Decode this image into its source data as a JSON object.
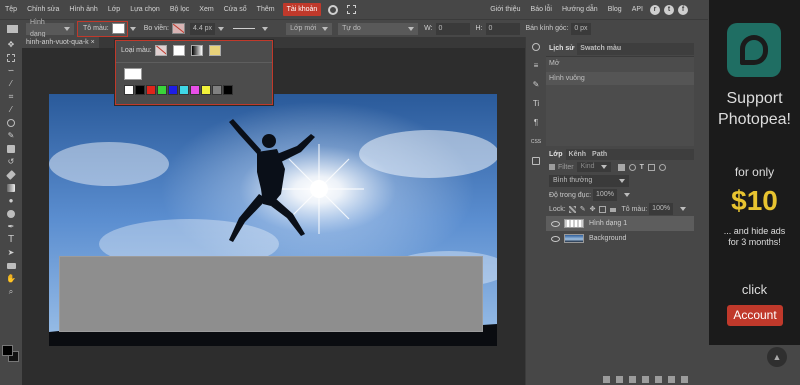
{
  "menu": {
    "items": [
      "Tệp",
      "Chỉnh sửa",
      "Hình ảnh",
      "Lớp",
      "Lựa chọn",
      "Bộ lọc",
      "Xem",
      "Cửa sổ",
      "Thêm"
    ],
    "account": "Tài khoản",
    "right": [
      "Giới thiệu",
      "Báo lỗi",
      "Hướng dẫn",
      "Blog",
      "API"
    ]
  },
  "options": {
    "shape_mode": "Hình dạng",
    "fill_label": "Tô màu:",
    "stroke_label": "Bo viền:",
    "stroke_width": "4.4 px",
    "layer_mode": "Lớp mới",
    "free_mode": "Tự do",
    "w": "0",
    "h": "0",
    "radius_label": "Bán kính góc:",
    "radius": "0 px"
  },
  "fill_popup": {
    "type_label": "Loại màu:",
    "palette": [
      "#ffffff",
      "#000000",
      "#e0251b",
      "#3ad33a",
      "#1e1ee6",
      "#3fd7e6",
      "#e84fe8",
      "#f2f23a",
      "#808080",
      "#000000"
    ]
  },
  "document": {
    "tab": "hinh-anh-vuot-qua-k",
    "close": "×"
  },
  "history": {
    "tabs": [
      "Lịch sử",
      "Swatch màu"
    ],
    "items": [
      "Mở",
      "Hình vuông"
    ]
  },
  "layers": {
    "tabs": [
      "Lớp",
      "Kênh",
      "Path"
    ],
    "filter_label": "Filter",
    "filter_value": "Kind",
    "blend_mode": "Bình thường",
    "opacity_label": "Độ trong đục:",
    "opacity": "100%",
    "lock_label": "Lock:",
    "fill_label": "Tô màu:",
    "fill": "100%",
    "items": [
      {
        "name": "Hình dạng 1",
        "thumb": "shape",
        "selected": true
      },
      {
        "name": "Background",
        "thumb": "photo",
        "selected": false
      }
    ]
  },
  "ad": {
    "line1": "Support",
    "line2": "Photopea!",
    "for_only": "for only",
    "price": "$10",
    "tagline1": "... and hide ads",
    "tagline2": "for 3 months!",
    "click": "click",
    "button": "Account"
  },
  "icons": {
    "sidebar": [
      "info-icon",
      "brush-settings-icon",
      "character-icon",
      "paragraph-icon",
      "css-icon"
    ],
    "scroll_top": "chevron-up-icon"
  },
  "colors": {
    "accent": "#c0392b",
    "ui_bg": "#474747",
    "workspace": "#2d2d2d",
    "ad_bg": "#1b1b1b",
    "ad_brand": "#1f6e63",
    "ad_price": "#e8c430"
  }
}
